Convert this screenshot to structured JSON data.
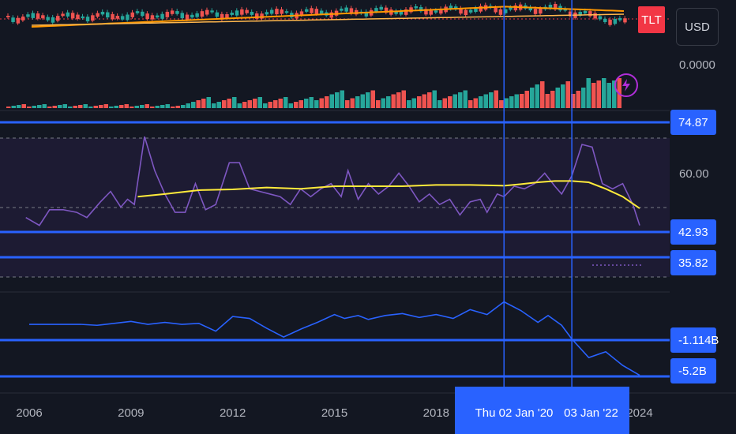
{
  "symbol": "TLT",
  "currency": "USD",
  "volume_scale_label": "0.0000",
  "colors": {
    "background": "#131722",
    "up": "#26a69a",
    "down": "#ef5350",
    "hline": "#2962ff",
    "tag": "#2962ff",
    "rsi": "#7e57c2",
    "rsi_ma": "#ffeb3b",
    "ma": "#ff9800",
    "obv": "#2962ff"
  },
  "chart_data": [
    {
      "type": "line",
      "panel": "price",
      "title": "",
      "x_tick_labels": [
        "2006",
        "2009",
        "2012",
        "2015",
        "2018",
        "2024"
      ],
      "series": [
        {
          "values_description": "monthly candles",
          "candles": "up/down alternating"
        },
        {
          "values_description": "moving average"
        }
      ]
    },
    {
      "type": "bar",
      "panel": "volume",
      "y_tick_labels": [
        "0.0000"
      ]
    },
    {
      "type": "line",
      "panel": "rsi",
      "y_tick_labels": [
        "60.00"
      ],
      "ylim": [
        20,
        85
      ],
      "level_labels": [
        "74.87",
        "42.93",
        "35.82"
      ],
      "levels": [
        74.87,
        42.93,
        35.82
      ],
      "x": [
        2005.9,
        2006.3,
        2006.6,
        2007.0,
        2007.4,
        2007.7,
        2008.1,
        2008.4,
        2008.7,
        2008.9,
        2009.1,
        2009.4,
        2009.7,
        2010.0,
        2010.3,
        2010.6,
        2010.9,
        2011.2,
        2011.5,
        2011.9,
        2012.2,
        2012.5,
        2012.8,
        2013.1,
        2013.4,
        2013.7,
        2014.0,
        2014.3,
        2014.6,
        2014.9,
        2015.2,
        2015.4,
        2015.7,
        2016.0,
        2016.3,
        2016.6,
        2016.9,
        2017.2,
        2017.5,
        2017.8,
        2018.1,
        2018.4,
        2018.7,
        2019.0,
        2019.3,
        2019.5,
        2019.8,
        2020.0,
        2020.3,
        2020.6,
        2020.9,
        2021.2,
        2021.5,
        2021.7,
        2022.0,
        2022.3,
        2022.6,
        2022.9,
        2023.2,
        2023.5,
        2023.8,
        2024.0
      ],
      "values": [
        47,
        44,
        50,
        50,
        49,
        47,
        53,
        57,
        51,
        54,
        52,
        78,
        65,
        56,
        49,
        49,
        60,
        50,
        52,
        68,
        68,
        58,
        57,
        56,
        55,
        52,
        58,
        55,
        58,
        60,
        55,
        65,
        54,
        60,
        56,
        59,
        64,
        59,
        53,
        56,
        52,
        54,
        48,
        53,
        54,
        49,
        56,
        55,
        59,
        58,
        60,
        64,
        59,
        56,
        63,
        75,
        74,
        60,
        58,
        60,
        52,
        44
      ],
      "ma_x": [
        2009.2,
        2010.0,
        2011.0,
        2012.0,
        2013.0,
        2014.0,
        2015.0,
        2016.0,
        2017.0,
        2018.0,
        2019.0,
        2020.0,
        2020.5,
        2021.0,
        2021.5,
        2022.0,
        2022.5,
        2023.0,
        2023.5,
        2024.0
      ],
      "ma_values": [
        55,
        56,
        57.5,
        57.8,
        58.5,
        58,
        59,
        59,
        59,
        59.5,
        59.5,
        59.2,
        59.8,
        60.5,
        61,
        61,
        60.5,
        58,
        55,
        50.5
      ]
    },
    {
      "type": "line",
      "panel": "on-balance-volume",
      "level_labels": [
        "-1.114B",
        "-5.2B"
      ],
      "levels": [
        -1.114,
        -5.2
      ],
      "ylim": [
        -5.4,
        2.5
      ],
      "x": [
        2006,
        2007,
        2007.5,
        2008,
        2008.5,
        2009,
        2009.5,
        2010,
        2010.5,
        2011,
        2011.5,
        2012,
        2012.5,
        2013,
        2013.5,
        2014,
        2014.5,
        2015,
        2015.3,
        2015.7,
        2016,
        2016.5,
        2017,
        2017.5,
        2018,
        2018.5,
        2019,
        2019.5,
        2020,
        2020.5,
        2021,
        2021.3,
        2021.7,
        2022,
        2022.5,
        2023,
        2023.5,
        2024
      ],
      "values": [
        0,
        0,
        0,
        -0.1,
        0.1,
        0.3,
        0,
        0.2,
        0,
        0.1,
        -0.7,
        0.8,
        0.6,
        -0.4,
        -1.3,
        -0.5,
        0.2,
        1.0,
        0.6,
        0.9,
        0.5,
        0.9,
        1.1,
        0.7,
        1.0,
        0.6,
        1.5,
        1.0,
        2.3,
        1.4,
        0.2,
        0.9,
        -0.1,
        -1.5,
        -3.4,
        -2.8,
        -4.2,
        -5.2
      ]
    }
  ],
  "x_axis": {
    "ticks": [
      "2006",
      "2009",
      "2012",
      "2015",
      "2018",
      "2024"
    ],
    "tick_years": [
      2006,
      2009,
      2012,
      2015,
      2018,
      2024
    ],
    "crosshair_labels": [
      "Thu 02 Jan '20",
      "03 Jan '22"
    ],
    "crosshair_years": [
      2020.0,
      2022.0
    ]
  }
}
